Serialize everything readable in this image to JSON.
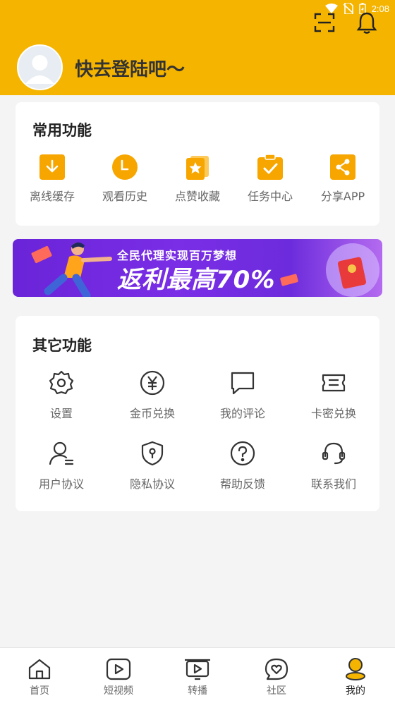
{
  "status": {
    "time": "2:08"
  },
  "header": {
    "login_prompt": "快去登陆吧～"
  },
  "common": {
    "title": "常用功能",
    "items": [
      {
        "label": "离线缓存",
        "icon": "download-icon"
      },
      {
        "label": "观看历史",
        "icon": "clock-icon"
      },
      {
        "label": "点赞收藏",
        "icon": "star-icon"
      },
      {
        "label": "任务中心",
        "icon": "checklist-icon"
      },
      {
        "label": "分享APP",
        "icon": "share-icon"
      }
    ]
  },
  "banner": {
    "line1": "全民代理实现百万梦想",
    "line2": "返利最高70%"
  },
  "other": {
    "title": "其它功能",
    "items": [
      {
        "label": "设置",
        "icon": "gear-icon"
      },
      {
        "label": "金币兑换",
        "icon": "yen-coin-icon"
      },
      {
        "label": "我的评论",
        "icon": "comment-icon"
      },
      {
        "label": "卡密兑换",
        "icon": "ticket-icon"
      },
      {
        "label": "用户协议",
        "icon": "user-agreement-icon"
      },
      {
        "label": "隐私协议",
        "icon": "privacy-shield-icon"
      },
      {
        "label": "帮助反馈",
        "icon": "help-icon"
      },
      {
        "label": "联系我们",
        "icon": "headset-icon"
      }
    ]
  },
  "tabs": [
    {
      "label": "首页",
      "icon": "home-icon"
    },
    {
      "label": "短视频",
      "icon": "short-video-icon"
    },
    {
      "label": "转播",
      "icon": "broadcast-icon"
    },
    {
      "label": "社区",
      "icon": "community-icon"
    },
    {
      "label": "我的",
      "icon": "profile-icon",
      "active": true
    }
  ],
  "colors": {
    "accent": "#f5b400",
    "icon_orange": "#f7a600",
    "text": "#333333"
  }
}
